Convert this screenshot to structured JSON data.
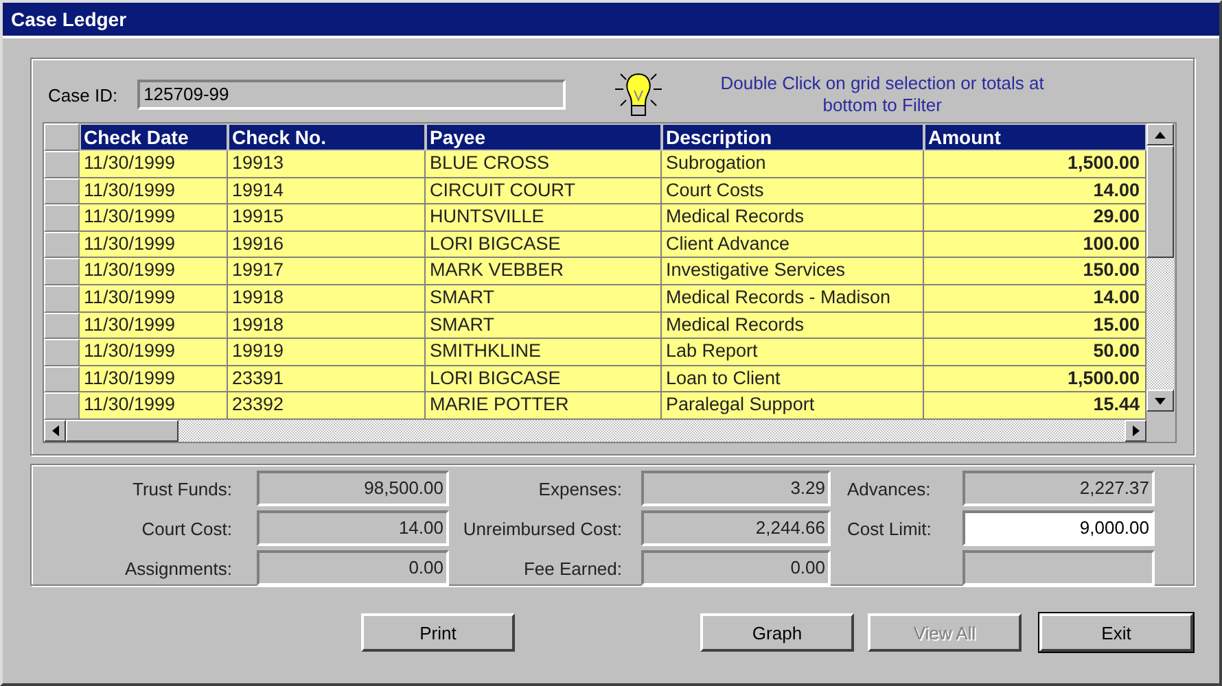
{
  "window": {
    "title": "Case Ledger"
  },
  "case_id": {
    "label": "Case ID:",
    "value": "125709-99"
  },
  "hint": "Double Click on grid selection or totals at bottom to Filter",
  "table": {
    "columns": [
      "Check Date",
      "Check No.",
      "Payee",
      "Description",
      "Amount"
    ],
    "rows": [
      [
        "11/30/1999",
        "19913",
        "BLUE CROSS",
        "Subrogation",
        "1,500.00"
      ],
      [
        "11/30/1999",
        "19914",
        "CIRCUIT COURT",
        "Court Costs",
        "14.00"
      ],
      [
        "11/30/1999",
        "19915",
        "HUNTSVILLE",
        "Medical Records",
        "29.00"
      ],
      [
        "11/30/1999",
        "19916",
        "LORI BIGCASE",
        "Client Advance",
        "100.00"
      ],
      [
        "11/30/1999",
        "19917",
        "MARK VEBBER",
        "Investigative Services",
        "150.00"
      ],
      [
        "11/30/1999",
        "19918",
        "SMART",
        "Medical Records - Madison",
        "14.00"
      ],
      [
        "11/30/1999",
        "19918",
        "SMART",
        "Medical Records",
        "15.00"
      ],
      [
        "11/30/1999",
        "19919",
        "SMITHKLINE",
        "Lab Report",
        "50.00"
      ],
      [
        "11/30/1999",
        "23391",
        "LORI BIGCASE",
        "Loan to Client",
        "1,500.00"
      ],
      [
        "11/30/1999",
        "23392",
        "MARIE POTTER",
        "Paralegal Support",
        "15.44"
      ]
    ]
  },
  "totals": [
    [
      {
        "label": "Trust Funds:",
        "value": "98,500.00",
        "editable": false
      },
      {
        "label": "Court Cost:",
        "value": "14.00",
        "editable": false
      },
      {
        "label": "Assignments:",
        "value": "0.00",
        "editable": false
      }
    ],
    [
      {
        "label": "Expenses:",
        "value": "3.29",
        "editable": false
      },
      {
        "label": "Unreimbursed  Cost:",
        "value": "2,244.66",
        "editable": false
      },
      {
        "label": "Fee Earned:",
        "value": "0.00",
        "editable": false
      }
    ],
    [
      {
        "label": "Advances:",
        "value": "2,227.37",
        "editable": false
      },
      {
        "label": "Cost Limit:",
        "value": "9,000.00",
        "editable": true
      },
      {
        "editable": false
      }
    ]
  ],
  "buttons": [
    {
      "label": "Print",
      "disabled": false,
      "default": false
    },
    {
      "label": "Graph",
      "disabled": false,
      "default": false
    },
    {
      "label": "View All",
      "disabled": true,
      "default": false
    },
    {
      "label": "Exit",
      "disabled": false,
      "default": true
    }
  ]
}
